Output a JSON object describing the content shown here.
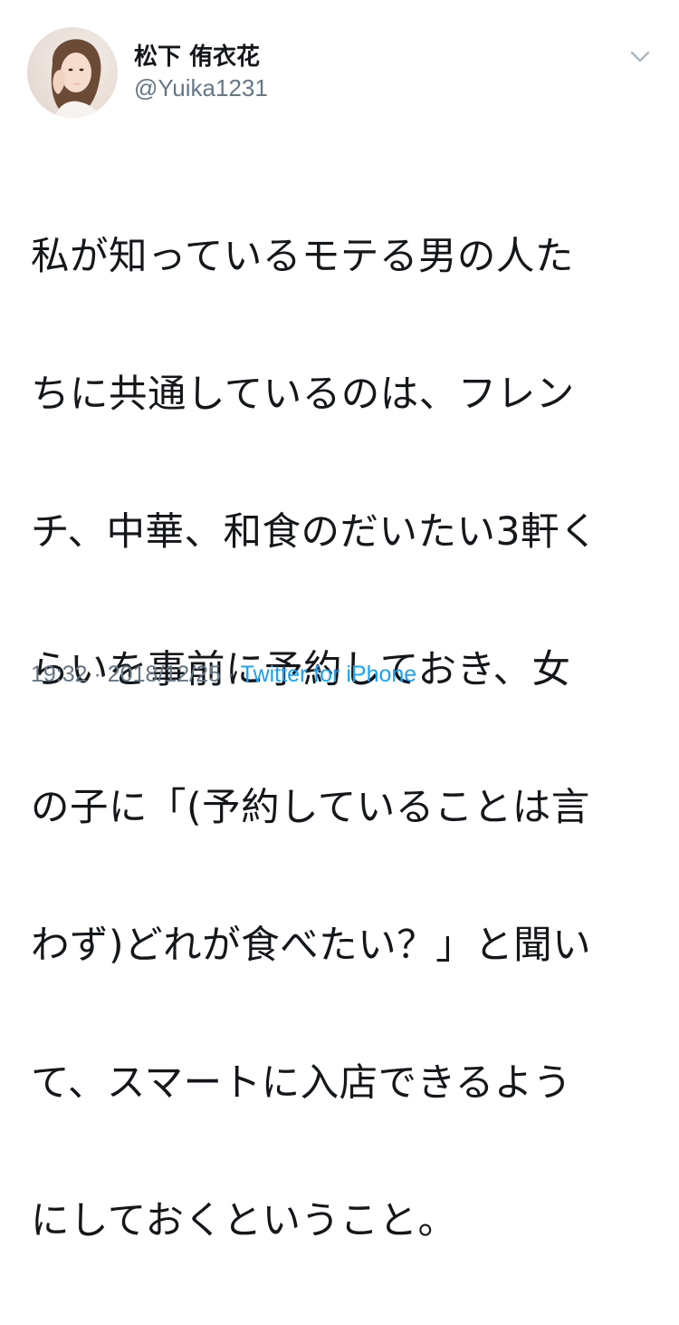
{
  "tweet": {
    "author": {
      "display_name": "松下 侑衣花",
      "handle": "@Yuika1231"
    },
    "body_lines": [
      "私が知っているモテる男の人た",
      "ちに共通しているのは、フレン",
      "チ、中華、和食のだいたい3軒く",
      "らいを事前に予約しておき、女",
      "の子に「(予約していることは言",
      "わず)どれが食べたい？」と聞い",
      "て、スマートに入店できるよう",
      "にしておくということ。"
    ],
    "time": "19:32",
    "date": "2018/12/25",
    "separator": " · ",
    "source": "Twitter for iPhone"
  },
  "icons": {
    "menu": "chevron-down-icon",
    "avatar": "profile-photo"
  },
  "colors": {
    "text": "#14171a",
    "secondary": "#657786",
    "link": "#1da1f2"
  }
}
